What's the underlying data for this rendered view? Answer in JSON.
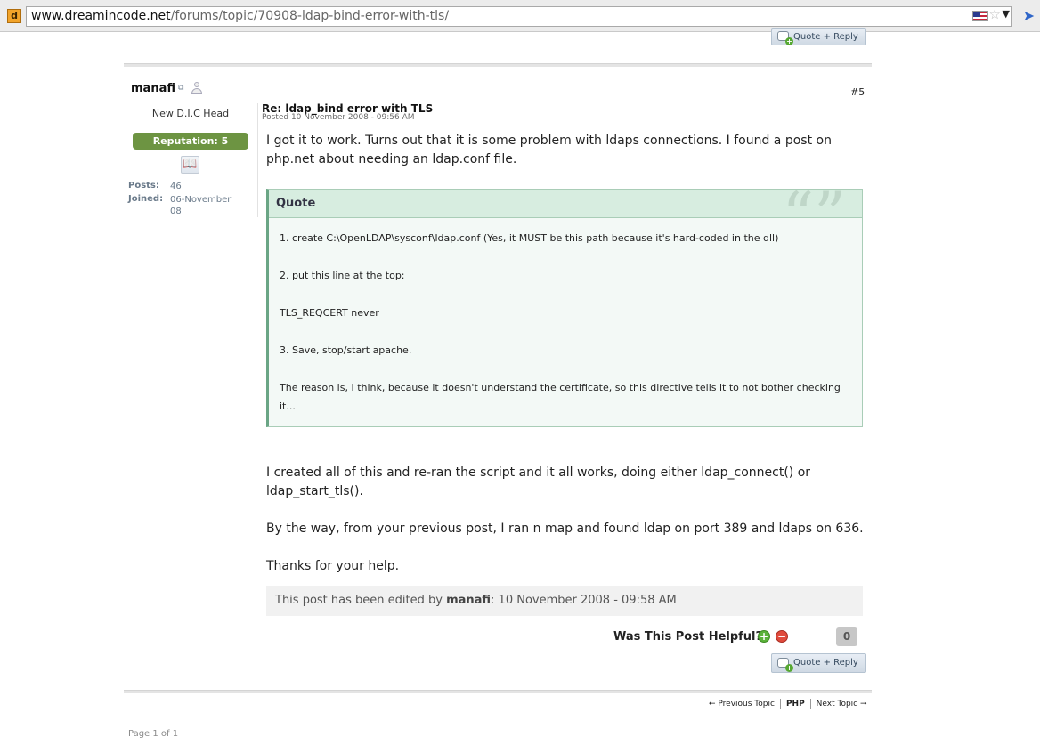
{
  "browser": {
    "favicon_letter": "d",
    "url_host": "www.dreamincode.net",
    "url_path": "/forums/topic/70908-ldap-bind-error-with-tls/"
  },
  "top_reply_button": "Quote + Reply",
  "author": {
    "name": "manafi",
    "title": "New D.I.C Head",
    "reputation": "Reputation: 5",
    "posts_label": "Posts:",
    "posts": "46",
    "joined_label": "Joined:",
    "joined": "06-November 08"
  },
  "post": {
    "number": "#5",
    "title": "Re: ldap_bind error with TLS",
    "date": "Posted 10 November 2008 - 09:56 AM",
    "intro": "I got it to work. Turns out that it is some problem with ldaps connections. I found a post on php.net about needing an ldap.conf file.",
    "quote": {
      "label": "Quote",
      "lines": [
        "1. create C:\\OpenLDAP\\sysconf\\ldap.conf (Yes, it MUST be this path because it's hard-coded in the dll)",
        "2. put this line at the top:",
        "TLS_REQCERT never",
        "3. Save, stop/start apache.",
        "The reason is, I think, because it doesn't understand the certificate, so this directive tells it to not bother checking it..."
      ]
    },
    "para1": "I created all of this and re-ran the script and it all works, doing either ldap_connect() or ldap_start_tls().",
    "para2": "By the way, from your previous post, I ran n map and found ldap on port 389 and ldaps on 636.",
    "para3": "Thanks for your help.",
    "edited_prefix": "This post has been edited by ",
    "edited_by": "manafi",
    "edited_suffix": ": 10 November 2008 - 09:58 AM"
  },
  "helpful": {
    "label": "Was This Post Helpful?",
    "count": "0"
  },
  "bottom_reply_button": "Quote + Reply",
  "topic_nav": {
    "previous": "← Previous Topic",
    "forum": "PHP",
    "next": "Next Topic →"
  },
  "pager": "Page 1 of 1",
  "colors": {
    "reputation_green": "#6d9442",
    "quote_header": "#d7ede0",
    "quote_border": "#6aa585"
  }
}
